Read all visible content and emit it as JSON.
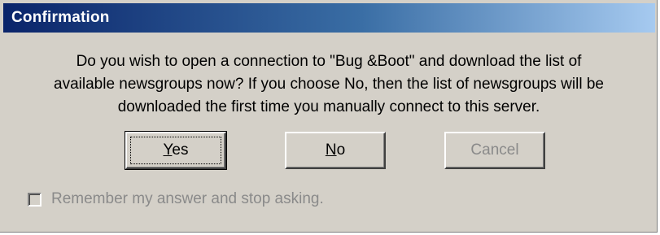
{
  "window": {
    "title": "Confirmation"
  },
  "message": {
    "lines": [
      "Do you wish to open a connection to \"Bug &Boot\" and download the list of",
      "available newsgroups now? If you choose No, then the list of newsgroups will be",
      "downloaded the first time you manually connect to this server."
    ]
  },
  "buttons": {
    "yes": {
      "mnemonic": "Y",
      "rest": "es"
    },
    "no": {
      "mnemonic": "N",
      "rest": "o"
    },
    "cancel": {
      "label": "Cancel"
    }
  },
  "checkbox": {
    "label": "Remember my answer and stop asking.",
    "checked": false,
    "disabled": true
  },
  "colors": {
    "title_start": "#0a246a",
    "title_end": "#a6caf0",
    "face": "#d4d0c8",
    "disabled_text": "#8a8a8a"
  }
}
